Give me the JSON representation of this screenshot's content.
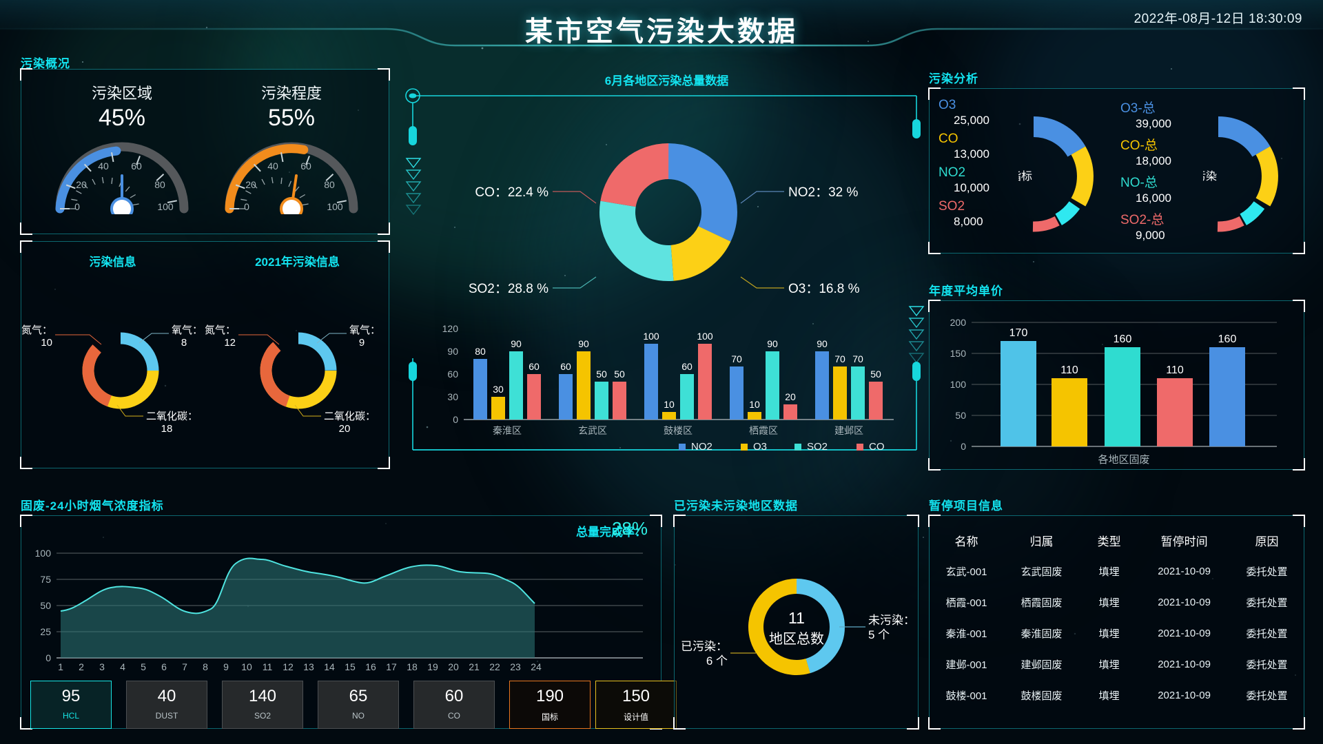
{
  "header": {
    "title": "某市空气污染大数据",
    "datetime": "2022年-08月-12日 18:30:09"
  },
  "sections": {
    "overview": "污染概况",
    "info": "污染信息",
    "center_donut": "6月各地区污染总量数据",
    "analysis": "污染分析",
    "annual_price": "年度平均单价",
    "hourly": "固废-24小时烟气浓度指标",
    "region_donut": "已污染未污染地区数据",
    "paused": "暂停项目信息"
  },
  "gauges": [
    {
      "label": "污染区域",
      "value": "45%",
      "num": 45,
      "color": "#4a90e2",
      "ticks": [
        "0",
        "20",
        "40",
        "60",
        "80",
        "100"
      ]
    },
    {
      "label": "污染程度",
      "value": "55%",
      "num": 55,
      "color": "#f28c1c",
      "ticks": [
        "0",
        "20",
        "40",
        "60",
        "80",
        "100"
      ]
    }
  ],
  "info_donuts": [
    {
      "title": "污染信息",
      "slices": [
        {
          "name": "氧气：",
          "value": 8,
          "color": "#5ec8ef"
        },
        {
          "name": "二氧化碳：",
          "value": 18,
          "color": "#fcd016"
        },
        {
          "name": "氮气：",
          "value": 10,
          "color": "#e8673c"
        }
      ]
    },
    {
      "title": "2021年污染信息",
      "slices": [
        {
          "name": "氧气：",
          "value": 9,
          "color": "#5ec8ef"
        },
        {
          "name": "二氧化碳：",
          "value": 20,
          "color": "#fcd016"
        },
        {
          "name": "氮气：",
          "value": 12,
          "color": "#e8673c"
        }
      ]
    }
  ],
  "chart_data": [
    {
      "id": "center_donut",
      "type": "pie",
      "title": "6月各地区污染总量数据",
      "labels": [
        "NO2",
        "O3",
        "SO2",
        "CO"
      ],
      "values": [
        32,
        16.8,
        28.8,
        22.4
      ],
      "display": [
        "NO2：32 %",
        "O3：16.8 %",
        "SO2：28.8 %",
        "CO：22.4 %"
      ],
      "colors": [
        "#4a90e2",
        "#fcd016",
        "#5fe3e0",
        "#ef6a6a"
      ],
      "legend": "outside-callout"
    },
    {
      "id": "region_bars",
      "type": "bar",
      "title": "",
      "categories": [
        "秦淮区",
        "玄武区",
        "鼓楼区",
        "栖霞区",
        "建邺区"
      ],
      "series": [
        {
          "name": "NO2",
          "color": "#4a90e2",
          "values": [
            80,
            60,
            100,
            70,
            90
          ]
        },
        {
          "name": "O3",
          "color": "#f5c400",
          "values": [
            30,
            90,
            10,
            10,
            70
          ]
        },
        {
          "name": "SO2",
          "color": "#3ee0d6",
          "values": [
            90,
            50,
            60,
            90,
            70
          ]
        },
        {
          "name": "CO",
          "color": "#ef6a6a",
          "values": [
            60,
            50,
            100,
            20,
            50
          ]
        }
      ],
      "yticks": [
        "0",
        "30",
        "60",
        "90",
        "120"
      ],
      "ylim": [
        0,
        120
      ],
      "grid": false,
      "legend": "bottom"
    },
    {
      "id": "annual_price",
      "type": "bar",
      "title": "年度平均单价",
      "xlabel": "各地区固废",
      "categories": [
        "",
        "",
        "",
        "",
        ""
      ],
      "values": [
        170,
        110,
        160,
        110,
        160
      ],
      "colors": [
        "#4fc3e8",
        "#f5c400",
        "#2fdcd0",
        "#ef6a6a",
        "#4a90e2"
      ],
      "yticks": [
        "0",
        "50",
        "100",
        "150",
        "200"
      ],
      "ylim": [
        0,
        200
      ],
      "grid": true
    },
    {
      "id": "hourly_area",
      "type": "area",
      "title": "固废-24小时烟气浓度指标",
      "x": [
        "1",
        "2",
        "3",
        "4",
        "5",
        "6",
        "7",
        "8",
        "9",
        "10",
        "11",
        "12",
        "13",
        "14",
        "15",
        "16",
        "17",
        "18",
        "19",
        "20",
        "21",
        "22",
        "23",
        "24"
      ],
      "values": [
        45,
        52,
        60,
        65,
        65,
        60,
        50,
        45,
        62,
        94,
        94,
        88,
        82,
        80,
        78,
        74,
        70,
        78,
        84,
        88,
        84,
        82,
        76,
        58
      ],
      "yticks": [
        "0",
        "25",
        "50",
        "75",
        "100"
      ],
      "ylim": [
        0,
        110
      ],
      "line_color": "#4fe4e0",
      "fill_color": "rgba(45,120,120,0.55)",
      "grid": true
    },
    {
      "id": "region_donut",
      "type": "pie",
      "title": "已污染未污染地区数据",
      "labels": [
        "已污染：",
        "未污染："
      ],
      "values": [
        6,
        5
      ],
      "units": [
        "6 个",
        "5 个"
      ],
      "colors": [
        "#f5c400",
        "#5ec8ef"
      ],
      "center_value": "11",
      "center_label": "地区总数"
    }
  ],
  "analysis": {
    "left": {
      "center_label": "污染指标",
      "items": [
        {
          "name": "O3",
          "value": "25,000",
          "color": "#4a90e2"
        },
        {
          "name": "CO",
          "value": "13,000",
          "color": "#f5c400"
        },
        {
          "name": "NO2",
          "value": "10,000",
          "color": "#2fdcd0"
        },
        {
          "name": "SO2",
          "value": "8,000",
          "color": "#ef6a6a"
        }
      ]
    },
    "right": {
      "center_label": "总污染",
      "items": [
        {
          "name": "O3-总",
          "value": "39,000",
          "color": "#4a90e2"
        },
        {
          "name": "CO-总",
          "value": "18,000",
          "color": "#f5c400"
        },
        {
          "name": "NO-总",
          "value": "16,000",
          "color": "#2fdcd0"
        },
        {
          "name": "SO2-总",
          "value": "9,000",
          "color": "#ef6a6a"
        }
      ]
    }
  },
  "hourly": {
    "rate_label": "总量完成率：",
    "rate_value": "28%",
    "metrics": [
      {
        "value": "95",
        "unit": "HCL",
        "style": "active"
      },
      {
        "value": "40",
        "unit": "DUST",
        "style": "normal"
      },
      {
        "value": "140",
        "unit": "SO2",
        "style": "normal"
      },
      {
        "value": "65",
        "unit": "NO",
        "style": "normal"
      },
      {
        "value": "60",
        "unit": "CO",
        "style": "normal"
      },
      {
        "value": "190",
        "unit": "国标",
        "style": "warn-o"
      },
      {
        "value": "150",
        "unit": "设计值",
        "style": "warn-y"
      }
    ]
  },
  "paused_table": {
    "columns": [
      "名称",
      "归属",
      "类型",
      "暂停时间",
      "原因"
    ],
    "rows": [
      [
        "玄武-001",
        "玄武固废",
        "填埋",
        "2021-10-09",
        "委托处置"
      ],
      [
        "栖霞-001",
        "栖霞固废",
        "填埋",
        "2021-10-09",
        "委托处置"
      ],
      [
        "秦淮-001",
        "秦淮固废",
        "填埋",
        "2021-10-09",
        "委托处置"
      ],
      [
        "建邺-001",
        "建邺固废",
        "填埋",
        "2021-10-09",
        "委托处置"
      ],
      [
        "鼓楼-001",
        "鼓楼固废",
        "填埋",
        "2021-10-09",
        "委托处置"
      ]
    ]
  },
  "theme": {
    "accent": "#13e3ef",
    "panel_border": "#16b4be",
    "bg": "#020a10"
  }
}
